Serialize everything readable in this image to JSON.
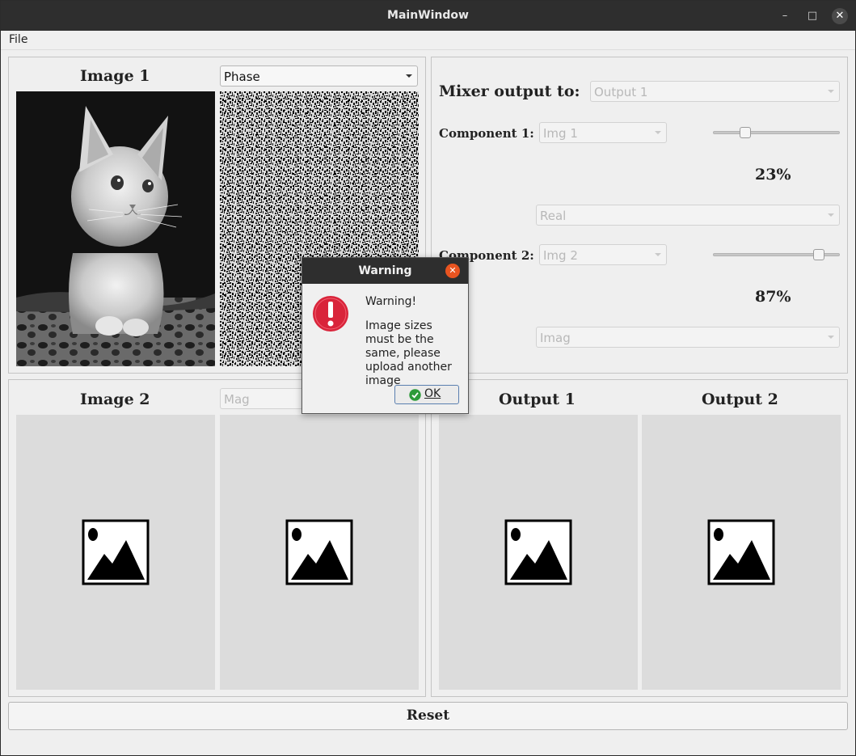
{
  "window": {
    "title": "MainWindow"
  },
  "menu": {
    "file": "File"
  },
  "image1": {
    "label": "Image 1",
    "component_select": "Phase"
  },
  "image2": {
    "label": "Image 2",
    "component_select": "Mag"
  },
  "mixer": {
    "output_label": "Mixer output to:",
    "output_select": "Output 1",
    "component1": {
      "label": "Component 1:",
      "image_select": "Img 1",
      "percent": 23,
      "percent_text": "23%",
      "type_select": "Real"
    },
    "component2": {
      "label": "Component 2:",
      "image_select": "Img 2",
      "percent": 87,
      "percent_text": "87%",
      "type_select": "Imag"
    }
  },
  "outputs": {
    "output1_label": "Output 1",
    "output2_label": "Output 2"
  },
  "reset_label": "Reset",
  "dialog": {
    "title": "Warning",
    "heading": "Warning!",
    "message": "Image sizes must be the same, please upload another image",
    "ok_label": "OK"
  },
  "icons": {
    "close": "close-icon",
    "warning": "exclamation-icon",
    "ok": "check-icon",
    "placeholder": "image-placeholder-icon"
  },
  "colors": {
    "accent_orange": "#e95420",
    "warning_red": "#d9243a",
    "ok_green": "#2e9b3a"
  }
}
